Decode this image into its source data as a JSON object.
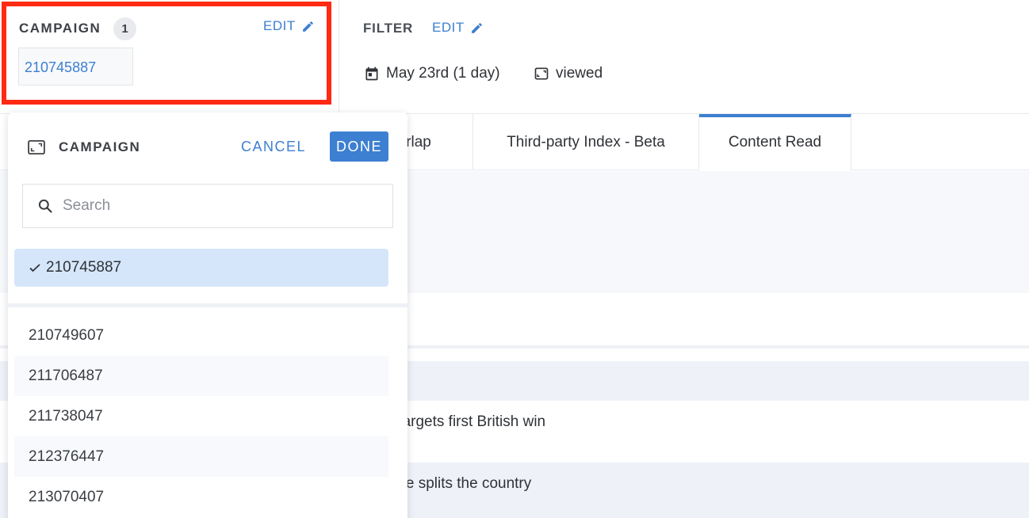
{
  "campaign_panel": {
    "title": "CAMPAIGN",
    "count": "1",
    "edit_label": "EDIT",
    "selected_value": "210745887",
    "highlight_color": "#ff2a12"
  },
  "filter": {
    "title": "FILTER",
    "edit_label": "EDIT",
    "date_range": "May 23rd (1 day)",
    "date_icon": "calendar-icon",
    "event": "viewed",
    "event_icon": "image-frame-icon"
  },
  "tabs": [
    {
      "label": "verlap",
      "active": false
    },
    {
      "label": "Third-party Index - Beta",
      "active": false
    },
    {
      "label": "Content Read",
      "active": true
    }
  ],
  "background_rows": [
    "s team targets first British win",
    "pineapple splits the country"
  ],
  "dropdown": {
    "header_icon": "image-frame-icon",
    "title": "CAMPAIGN",
    "cancel_label": "CANCEL",
    "done_label": "DONE",
    "search_placeholder": "Search",
    "selected_item": "210745887",
    "items": [
      "210749607",
      "211706487",
      "211738047",
      "212376447",
      "213070407"
    ]
  },
  "colors": {
    "accent": "#3d7fd0",
    "selected_bg": "#d6e6fa",
    "text": "#2f3237"
  }
}
